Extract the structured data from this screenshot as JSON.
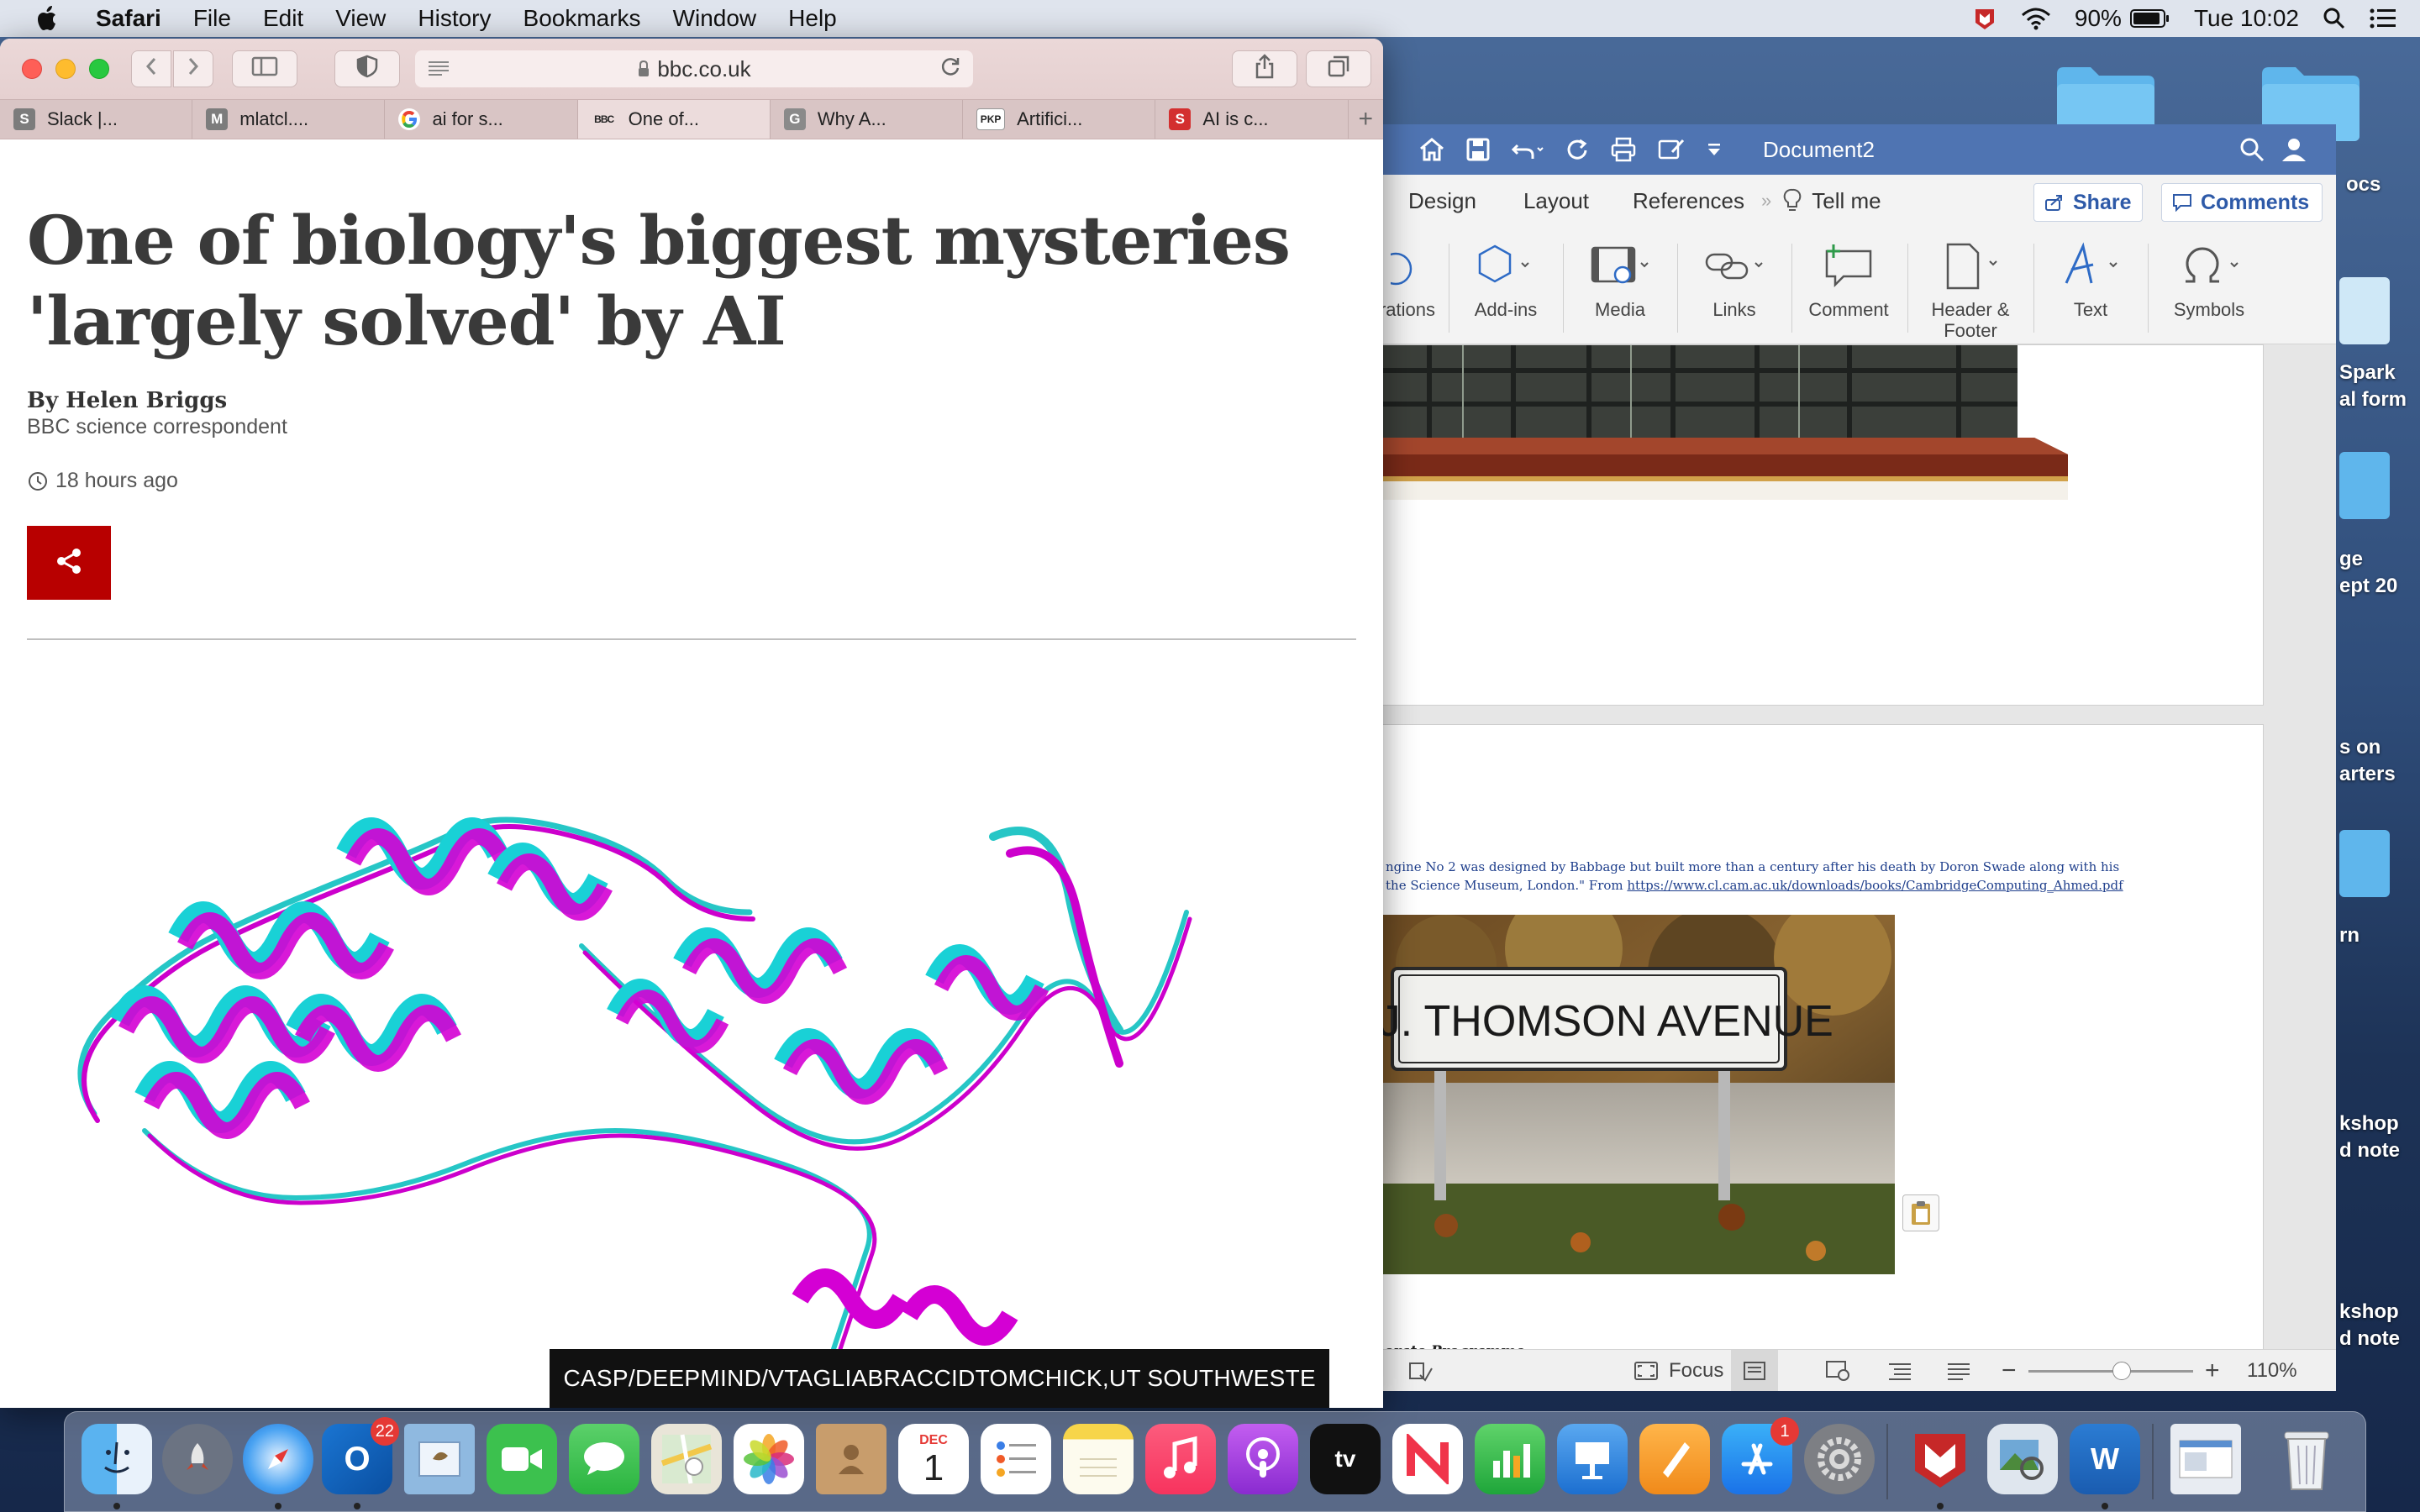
{
  "menubar": {
    "app_name": "Safari",
    "menus": [
      "File",
      "Edit",
      "View",
      "History",
      "Bookmarks",
      "Window",
      "Help"
    ],
    "battery": "90%",
    "clock": "Tue 10:02"
  },
  "safari": {
    "url": "bbc.co.uk",
    "tabs": [
      {
        "label": "Slack |...",
        "icon": "S",
        "color": "#7c7c7c"
      },
      {
        "label": "mlatcl....",
        "icon": "M",
        "color": "#7c7c7c"
      },
      {
        "label": "ai for s...",
        "icon": "G",
        "color": "#ffffff"
      },
      {
        "label": "One of...",
        "icon": "BBC",
        "color": "#222222"
      },
      {
        "label": "Why A...",
        "icon": "G",
        "color": "#8a8a8a"
      },
      {
        "label": "Artifici...",
        "icon": "PKP",
        "color": "#ffffff"
      },
      {
        "label": "AI is c...",
        "icon": "S",
        "color": "#d32f2f"
      }
    ]
  },
  "article": {
    "headline_line1": "One of biology's biggest mysteries",
    "headline_line2": "'largely solved' by AI",
    "author": "By Helen Briggs",
    "role": "BBC science correspondent",
    "time": "18 hours ago",
    "image_caption": "CASP/DEEPMIND/VTAGLIABRACCIDTOMCHICK,UT SOUTHWESTE"
  },
  "word": {
    "doc_title": "Document2",
    "ribbon_tabs": [
      "Design",
      "Layout",
      "References",
      "Tell me"
    ],
    "share_label": "Share",
    "comments_label": "Comments",
    "ribbon_groups": [
      {
        "label": "rations"
      },
      {
        "label": "Add-ins"
      },
      {
        "label": "Media"
      },
      {
        "label": "Links"
      },
      {
        "label": "Comment"
      },
      {
        "label": "Header &\nFooter"
      },
      {
        "label": "Text"
      },
      {
        "label": "Symbols"
      }
    ],
    "doc_caption_line1": "ngine No 2 was designed by Babbage but built more than a century after his death by Doron Swade along with his",
    "doc_caption_line2_text": "the Science Museum, London.\" From ",
    "doc_caption_link": "https://www.cl.cam.ac.uk/downloads/books/CambridgeComputing_Ahmed.pdf",
    "sign_text": "J.J. THOMSON AVENUE",
    "bottom_text": "orate Programme",
    "focus_label": "Focus",
    "zoom": "110%"
  },
  "desktop_labels": [
    {
      "text": "ocs"
    },
    {
      "text": "Spark\nal form"
    },
    {
      "text": "ge\nept 20"
    },
    {
      "text": "s on\narters"
    },
    {
      "text": "rn"
    },
    {
      "text": "kshop\nd note"
    },
    {
      "text": "kshop\nd note"
    }
  ],
  "dock": {
    "outlook_badge": "22",
    "appstore_badge": "1",
    "calendar_month": "DEC",
    "calendar_day": "1"
  }
}
